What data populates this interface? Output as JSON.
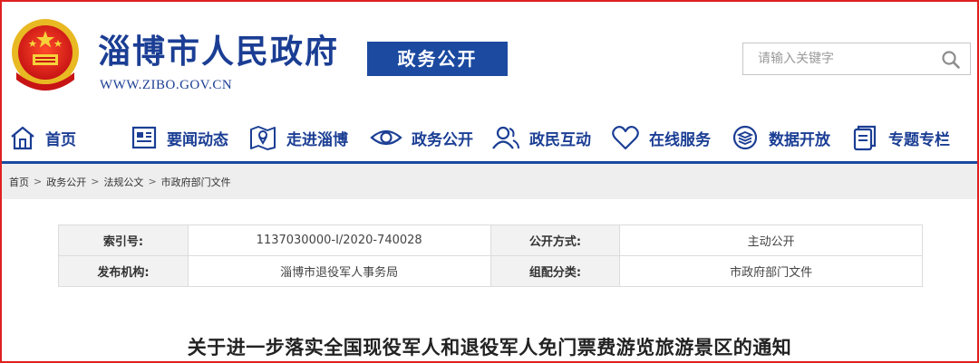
{
  "header": {
    "title": "淄博市人民政府",
    "url": "WWW.ZIBO.GOV.CN",
    "section_badge": "政务公开",
    "search_placeholder": "请输入关键字"
  },
  "nav": {
    "items": [
      {
        "label": "首页",
        "icon": "home-icon"
      },
      {
        "label": "要闻动态",
        "icon": "news-icon"
      },
      {
        "label": "走进淄博",
        "icon": "map-icon"
      },
      {
        "label": "政务公开",
        "icon": "eye-icon"
      },
      {
        "label": "政民互动",
        "icon": "people-icon"
      },
      {
        "label": "在线服务",
        "icon": "heart-icon"
      },
      {
        "label": "数据开放",
        "icon": "database-icon"
      },
      {
        "label": "专题专栏",
        "icon": "document-icon"
      }
    ]
  },
  "breadcrumb": [
    "首页",
    "政务公开",
    "法规公文",
    "市政府部门文件"
  ],
  "info": {
    "rows": [
      {
        "label1": "索引号:",
        "value1": "1137030000-I/2020-740028",
        "label2": "公开方式:",
        "value2": "主动公开"
      },
      {
        "label1": "发布机构:",
        "value1": "淄博市退役军人事务局",
        "label2": "组配分类:",
        "value2": "市政府部门文件"
      }
    ]
  },
  "article": {
    "title": "关于进一步落实全国现役军人和退役军人免门票费游览旅游景区的通知"
  },
  "colors": {
    "brand_blue": "#1b3e94",
    "badge_blue": "#1b4aa0",
    "frame_red": "#e02020"
  }
}
